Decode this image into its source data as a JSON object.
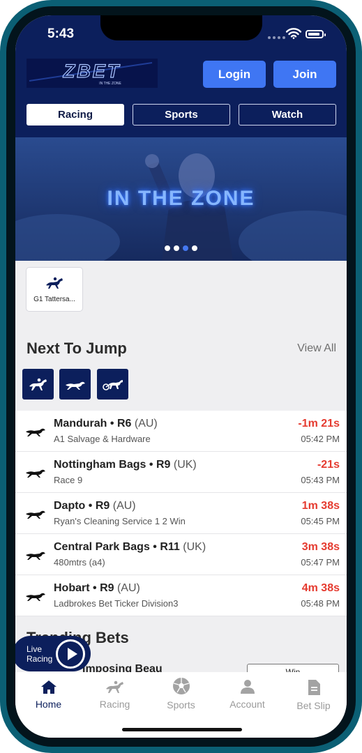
{
  "status_bar": {
    "time": "5:43"
  },
  "header": {
    "logo_text": "ZBET",
    "logo_tagline": "IN THE ZONE",
    "login_label": "Login",
    "join_label": "Join"
  },
  "tabs": [
    {
      "label": "Racing",
      "active": true
    },
    {
      "label": "Sports",
      "active": false
    },
    {
      "label": "Watch",
      "active": false
    }
  ],
  "hero": {
    "text": "IN THE ZONE",
    "slides": 4,
    "active_slide": 3
  },
  "feature": {
    "label": "G1 Tattersa..."
  },
  "next_to_jump": {
    "title": "Next To Jump",
    "view_all": "View All",
    "filters": [
      "horse-racing-icon",
      "greyhound-icon",
      "harness-racing-icon"
    ],
    "races": [
      {
        "venue": "Mandurah",
        "race": "R6",
        "country": "(AU)",
        "desc": "A1 Salvage & Hardware",
        "countdown": "-1m 21s",
        "time": "05:42 PM"
      },
      {
        "venue": "Nottingham Bags",
        "race": "R9",
        "country": "(UK)",
        "desc": "Race 9",
        "countdown": "-21s",
        "time": "05:43 PM"
      },
      {
        "venue": "Dapto",
        "race": "R9",
        "country": "(AU)",
        "desc": "Ryan's Cleaning Service 1 2 Win",
        "countdown": "1m 38s",
        "time": "05:45 PM"
      },
      {
        "venue": "Central Park Bags",
        "race": "R11",
        "country": "(UK)",
        "desc": "480mtrs (a4)",
        "countdown": "3m 38s",
        "time": "05:47 PM"
      },
      {
        "venue": "Hobart",
        "race": "R9",
        "country": "(AU)",
        "desc": "Ladbrokes Bet Ticker Division3",
        "countdown": "4m 38s",
        "time": "05:48 PM"
      }
    ]
  },
  "trending": {
    "title": "Trending Bets",
    "bet_name": "Imposing Beau",
    "bet_button": "Win"
  },
  "live": {
    "line1": "Live",
    "line2": "Racing"
  },
  "tabbar": [
    {
      "label": "Home",
      "icon": "home-icon",
      "active": true
    },
    {
      "label": "Racing",
      "icon": "horse-racing-icon",
      "active": false
    },
    {
      "label": "Sports",
      "icon": "soccer-ball-icon",
      "active": false
    },
    {
      "label": "Account",
      "icon": "user-icon",
      "active": false
    },
    {
      "label": "Bet Slip",
      "icon": "bet-slip-icon",
      "active": false
    }
  ],
  "colors": {
    "brand": "#0c1f5c",
    "accent": "#3f76f3",
    "countdown": "#e53b30"
  }
}
